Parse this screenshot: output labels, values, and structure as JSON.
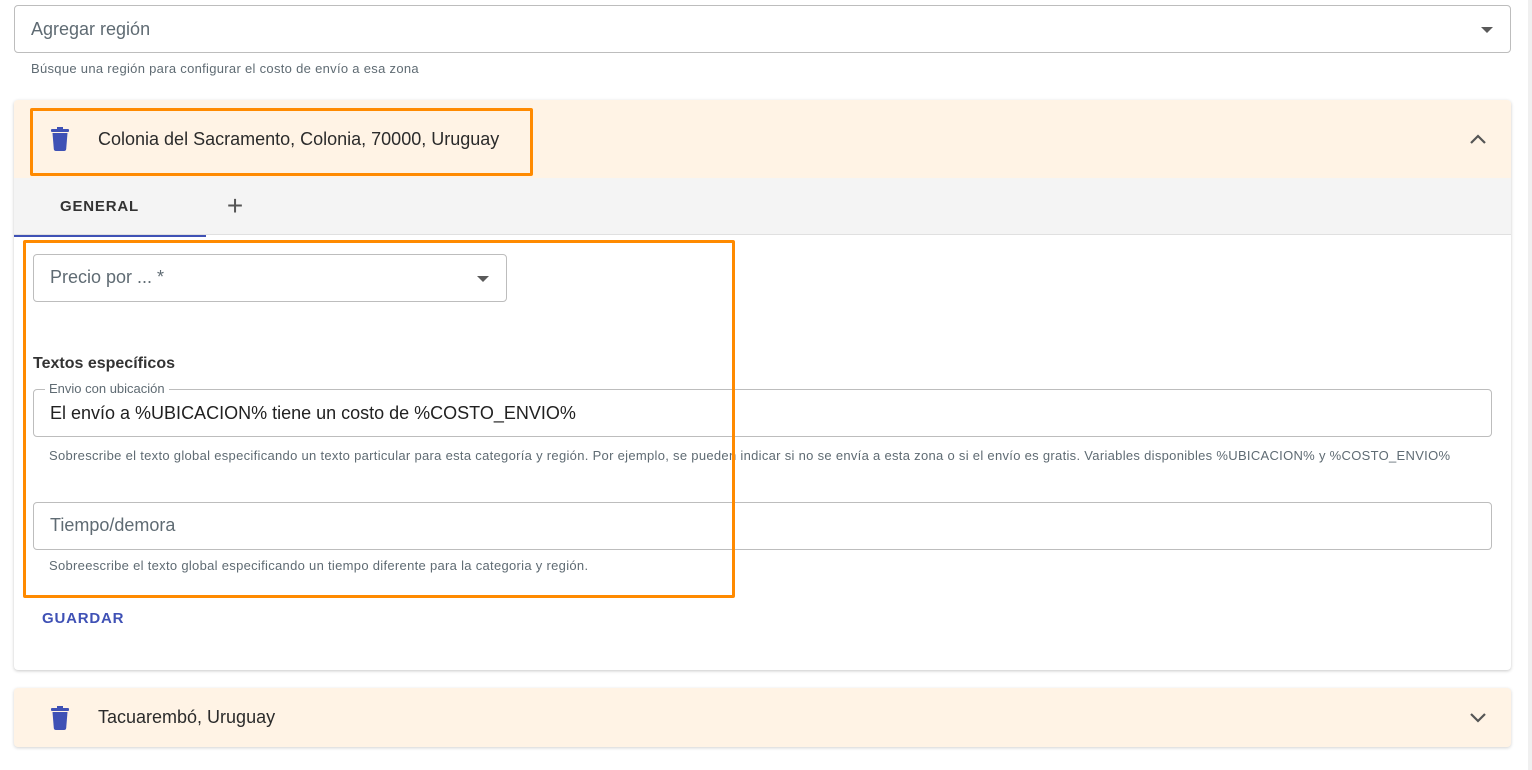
{
  "region_select": {
    "placeholder": "Agregar región",
    "hint": "Búsque una región para configurar el costo de envío a esa zona"
  },
  "regions": [
    {
      "name": "Colonia del Sacramento, Colonia, 70000, Uruguay",
      "expanded": true,
      "tabs": [
        {
          "label": "GENERAL",
          "active": true
        }
      ],
      "add_tab_label": "+",
      "price_select": {
        "placeholder": "Precio por ... *"
      },
      "specific_texts_title": "Textos específicos",
      "shipping_text": {
        "legend": "Envio con ubicación",
        "value": "El envío a %UBICACION% tiene un costo de %COSTO_ENVIO%",
        "hint": "Sobrescribe el texto global especificando un texto particular para esta categoría y región. Por ejemplo, se pueden indicar si no se envía a esta zona o si el envío es gratis. Variables disponibles %UBICACION% y %COSTO_ENVIO%"
      },
      "delay_text": {
        "placeholder": "Tiempo/demora",
        "hint": "Sobreescribe el texto global especificando un tiempo diferente para la categoria y región."
      },
      "save_label": "GUARDAR"
    },
    {
      "name": "Tacuarembó, Uruguay",
      "expanded": false
    }
  ],
  "colors": {
    "accent": "#3f51b5",
    "header_bg": "#fff3e5",
    "highlight": "#ff8a00"
  },
  "icons": [
    "trash-icon",
    "chevron-up-icon",
    "chevron-down-icon",
    "dropdown-caret-icon",
    "plus-icon"
  ]
}
